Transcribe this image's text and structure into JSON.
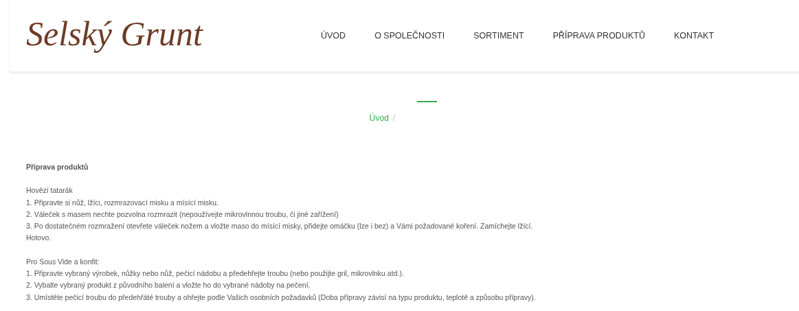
{
  "logo": "Selský Grunt",
  "nav": [
    "ÚVOD",
    "O SPOLEČNOSTI",
    "SORTIMENT",
    "PŘÍPRAVA PRODUKTŮ",
    "KONTAKT"
  ],
  "breadcrumb": {
    "items": [
      "Úvod"
    ],
    "separator": "/"
  },
  "content": {
    "heading": "Příprava produktů",
    "sections": [
      {
        "title": "Hovězí tatarák",
        "lines": [
          "1. Připravte si nůž, lžíci, rozmrazovací misku a mísící misku.",
          "2. Váleček s masem nechte pozvolna rozmrazit (nepoužívejte mikrovlnnou troubu, či jiné zařížení)",
          "3. Po dostatečném rozmražení otevřete váleček nožem a vložte maso do mísící misky, přidejte omáčku (lze i bez) a Vámi požadované koření. Zamíchejte lžící.",
          "Hotovo."
        ]
      },
      {
        "title": "Pro Sous Vide a konfit:",
        "lines": [
          "1. Připravte vybraný výrobek, nůžky nebo nůž, pečicí nádobu a předehřejte troubu (nebo použijte gril, mikrovlnku atd.).",
          "2. Vybalte vybraný produkt z původního balení a vložte ho do vybrané nádoby na pečení.",
          "3. Umístěte pečicí troubu do předehřáté trouby a ohřejte podle Vašich osobních požadavků (Doba přípravy závisí na typu produktu, teplotě a způsobu přípravy)."
        ]
      }
    ]
  }
}
